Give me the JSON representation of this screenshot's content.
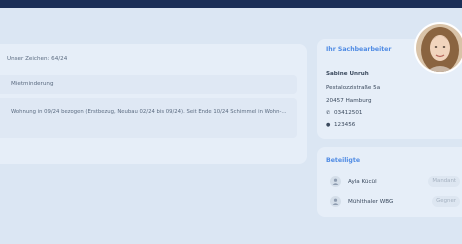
{
  "message": {
    "char_count": "Unser Zeichen: 64/24",
    "subject": "Mietminderung",
    "body": "Wohnung in 09/24 bezogen (Erstbezug, Neubau 02/24 bis 09/24). Seit Ende 10/24 Schimmel in Wohn-..."
  },
  "agent": {
    "title": "Ihr Sachbearbeiter",
    "name": "Sabine Unruh",
    "street": "Pestalozzistraße 5a",
    "city": "20457 Hamburg",
    "phone": "03412501",
    "fax": "123456",
    "phone_icon": "phone-icon",
    "fax_icon": "fax-icon"
  },
  "parties": {
    "title": "Beteiligte",
    "items": [
      {
        "name": "Ayla Kücül",
        "role": "Mandant",
        "icon": "person-icon"
      },
      {
        "name": "Mühlthaler WBG",
        "role": "Gegner",
        "icon": "person-icon"
      }
    ]
  },
  "colors": {
    "accent": "#4f8be4",
    "background": "#dbe6f3",
    "card": "#e6eef8",
    "topbar": "#1b2f57"
  }
}
